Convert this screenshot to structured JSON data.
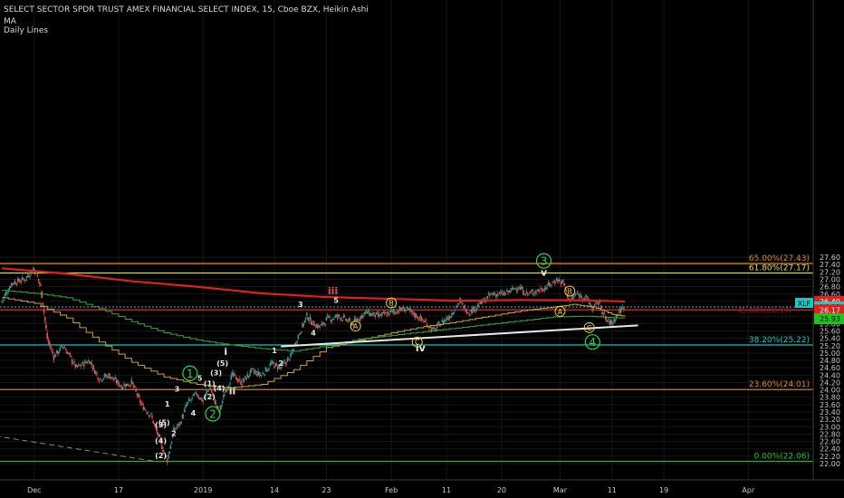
{
  "header": {
    "title": "SELECT SECTOR SPDR TRUST AMEX FINANCIAL SELECT INDEX, 15, Cboe BZX, Heikin Ashi",
    "indicator_1": "MA",
    "indicator_2": "Daily Lines"
  },
  "colors": {
    "background": "#000000",
    "candle_up": "#26a69a",
    "candle_down": "#ef5350",
    "ma_red": "#e0201c",
    "ma_green": "#3aa83a",
    "ma_yellow": "#c8a23a",
    "fib_orange": "#e08a1e",
    "fib_yellow": "#e0e020",
    "fib_cyan": "#1ec8c8",
    "fib_green": "#22c022",
    "trend_white": "#e8e8e8",
    "wave_green": "#22d84a",
    "wave_yellow": "#e8d23a"
  },
  "chart_data": {
    "type": "candlestick",
    "ylim": [
      21.8,
      27.7
    ],
    "x_ticks": [
      {
        "label": "Dec",
        "idx": 10
      },
      {
        "label": "17",
        "idx": 36
      },
      {
        "label": "2019",
        "idx": 62
      },
      {
        "label": "14",
        "idx": 84
      },
      {
        "label": "23",
        "idx": 100
      },
      {
        "label": "Feb",
        "idx": 120
      },
      {
        "label": "11",
        "idx": 137
      },
      {
        "label": "20",
        "idx": 154
      },
      {
        "label": "Mar",
        "idx": 172
      },
      {
        "label": "11",
        "idx": 188
      },
      {
        "label": "19",
        "idx": 204
      },
      {
        "label": "Apr",
        "idx": 230
      }
    ],
    "y_ticks": [
      22.0,
      22.2,
      22.4,
      22.6,
      22.8,
      23.0,
      23.2,
      23.4,
      23.6,
      23.8,
      24.0,
      24.2,
      24.4,
      24.6,
      24.8,
      25.0,
      25.2,
      25.4,
      25.6,
      25.8,
      26.0,
      26.2,
      26.4,
      26.6,
      26.8,
      27.0,
      27.2,
      27.4,
      27.6
    ],
    "price_anchors": [
      [
        0,
        26.4
      ],
      [
        3,
        26.9
      ],
      [
        7,
        27.0
      ],
      [
        10,
        27.3
      ],
      [
        12,
        26.8
      ],
      [
        14,
        25.4
      ],
      [
        16,
        24.9
      ],
      [
        19,
        25.2
      ],
      [
        23,
        24.6
      ],
      [
        27,
        24.8
      ],
      [
        30,
        24.3
      ],
      [
        33,
        24.4
      ],
      [
        37,
        24.1
      ],
      [
        40,
        24.2
      ],
      [
        43,
        23.6
      ],
      [
        46,
        23.3
      ],
      [
        48,
        22.8
      ],
      [
        50,
        22.3
      ],
      [
        51,
        22.1
      ],
      [
        53,
        22.9
      ],
      [
        55,
        23.1
      ],
      [
        57,
        23.6
      ],
      [
        60,
        23.9
      ],
      [
        62,
        23.7
      ],
      [
        64,
        24.1
      ],
      [
        66,
        23.6
      ],
      [
        67,
        23.4
      ],
      [
        69,
        24.0
      ],
      [
        71,
        24.4
      ],
      [
        74,
        24.2
      ],
      [
        77,
        24.5
      ],
      [
        80,
        24.4
      ],
      [
        83,
        24.7
      ],
      [
        86,
        24.6
      ],
      [
        89,
        24.9
      ],
      [
        91,
        25.4
      ],
      [
        94,
        26.0
      ],
      [
        96,
        25.8
      ],
      [
        98,
        25.7
      ],
      [
        100,
        25.9
      ],
      [
        104,
        26.0
      ],
      [
        108,
        25.8
      ],
      [
        112,
        26.1
      ],
      [
        116,
        26.0
      ],
      [
        120,
        26.1
      ],
      [
        124,
        26.2
      ],
      [
        128,
        26.0
      ],
      [
        131,
        25.8
      ],
      [
        133,
        25.6
      ],
      [
        135,
        25.8
      ],
      [
        138,
        26.0
      ],
      [
        141,
        26.4
      ],
      [
        144,
        26.1
      ],
      [
        147,
        26.3
      ],
      [
        151,
        26.6
      ],
      [
        155,
        26.6
      ],
      [
        159,
        26.8
      ],
      [
        162,
        26.6
      ],
      [
        165,
        26.7
      ],
      [
        168,
        26.8
      ],
      [
        171,
        27.0
      ],
      [
        173,
        26.9
      ],
      [
        175,
        26.4
      ],
      [
        177,
        26.6
      ],
      [
        180,
        26.5
      ],
      [
        182,
        26.2
      ],
      [
        184,
        26.4
      ],
      [
        186,
        25.9
      ],
      [
        188,
        25.8
      ],
      [
        190,
        26.1
      ],
      [
        192,
        26.3
      ]
    ],
    "last_index": 192,
    "x_max_index": 250,
    "ma_red": [
      [
        0,
        27.3
      ],
      [
        20,
        27.15
      ],
      [
        40,
        26.95
      ],
      [
        60,
        26.8
      ],
      [
        80,
        26.62
      ],
      [
        100,
        26.52
      ],
      [
        120,
        26.47
      ],
      [
        140,
        26.42
      ],
      [
        160,
        26.44
      ],
      [
        180,
        26.43
      ],
      [
        192,
        26.4
      ]
    ],
    "ma_green": [
      [
        0,
        26.7
      ],
      [
        10,
        26.62
      ],
      [
        20,
        26.5
      ],
      [
        30,
        26.2
      ],
      [
        40,
        25.85
      ],
      [
        50,
        25.55
      ],
      [
        60,
        25.35
      ],
      [
        70,
        25.22
      ],
      [
        80,
        25.12
      ],
      [
        90,
        25.05
      ],
      [
        100,
        25.2
      ],
      [
        110,
        25.38
      ],
      [
        120,
        25.48
      ],
      [
        130,
        25.58
      ],
      [
        140,
        25.68
      ],
      [
        150,
        25.78
      ],
      [
        160,
        25.88
      ],
      [
        170,
        25.98
      ],
      [
        180,
        26.0
      ],
      [
        188,
        25.96
      ],
      [
        192,
        25.95
      ]
    ],
    "ma_yellow": [
      [
        0,
        26.5
      ],
      [
        10,
        26.35
      ],
      [
        20,
        25.95
      ],
      [
        30,
        25.3
      ],
      [
        40,
        24.75
      ],
      [
        50,
        24.35
      ],
      [
        60,
        24.15
      ],
      [
        70,
        24.05
      ],
      [
        80,
        24.15
      ],
      [
        90,
        24.55
      ],
      [
        100,
        25.15
      ],
      [
        110,
        25.35
      ],
      [
        120,
        25.55
      ],
      [
        130,
        25.72
      ],
      [
        140,
        25.85
      ],
      [
        150,
        26.0
      ],
      [
        160,
        26.15
      ],
      [
        170,
        26.25
      ],
      [
        176,
        26.32
      ],
      [
        182,
        26.25
      ],
      [
        188,
        26.05
      ],
      [
        192,
        26.0
      ]
    ],
    "fib_levels": [
      {
        "label": "65.00%(27.43)",
        "value": 27.43,
        "color": "#e08a1e"
      },
      {
        "label": "61.80%(27.17)",
        "value": 27.17,
        "color": "#e0e020"
      },
      {
        "label": "38.20%(25.22)",
        "value": 25.22,
        "color": "#1ec8c8"
      },
      {
        "label": "23.60%(24.01)",
        "value": 24.01,
        "color": "#e08a1e"
      },
      {
        "label": "0.00%(22.06)",
        "value": 22.06,
        "color": "#22c022"
      }
    ],
    "red_hline": {
      "value": 26.17,
      "label": "45.00%(26.17)"
    },
    "price_markers": [
      {
        "label": "26.40",
        "value": 26.4,
        "bg": "#e0201c",
        "fg": "#ffffff"
      },
      {
        "label": "26.25",
        "value": 26.25,
        "bg": "#1ec8c8",
        "fg": "#000000"
      },
      {
        "label": "26.17",
        "value": 26.17,
        "bg": "#e0201c",
        "fg": "#ffffff"
      },
      {
        "label": "25.93",
        "value": 25.93,
        "bg": "#22c022",
        "fg": "#000000"
      }
    ],
    "symbol_tag": "XLF",
    "current_price": 26.25,
    "trendlines": [
      {
        "x1": 86,
        "y1": 25.18,
        "x2": 196,
        "y2": 25.75,
        "color": "#e8e8e8",
        "dashed": false
      },
      {
        "x1": -2,
        "y1": 22.75,
        "x2": 48,
        "y2": 22.05,
        "color": "#8a8a8a",
        "dashed": true
      }
    ],
    "wave_labels": [
      {
        "text": "3",
        "style": "circle-green",
        "idx": 167,
        "price": 27.5
      },
      {
        "text": "4",
        "style": "circle-green",
        "idx": 182,
        "price": 25.3
      },
      {
        "text": "1",
        "style": "circle-green",
        "idx": 58,
        "price": 24.45
      },
      {
        "text": "2",
        "style": "circle-green",
        "idx": 65,
        "price": 23.35
      },
      {
        "text": "v",
        "style": "plain",
        "idx": 167,
        "price": 27.1
      },
      {
        "text": "iii",
        "style": "plain-red",
        "idx": 102,
        "price": 26.6
      },
      {
        "text": "iv",
        "style": "plain",
        "idx": 129,
        "price": 25.05
      },
      {
        "text": "i",
        "style": "plain",
        "idx": 69,
        "price": 24.95
      },
      {
        "text": "ii",
        "style": "plain",
        "idx": 71,
        "price": 23.88
      },
      {
        "text": "B",
        "style": "circle-yellow",
        "idx": 120,
        "price": 26.36
      },
      {
        "text": "A",
        "style": "circle-yellow",
        "idx": 109,
        "price": 25.73
      },
      {
        "text": "C",
        "style": "circle-yellow",
        "idx": 128,
        "price": 25.3
      },
      {
        "text": "B",
        "style": "circle-yellow",
        "idx": 175,
        "price": 26.68
      },
      {
        "text": "A",
        "style": "circle-yellow",
        "idx": 172,
        "price": 26.13
      },
      {
        "text": "C",
        "style": "circle-yellow",
        "idx": 181,
        "price": 25.69
      },
      {
        "text": "3",
        "style": "small",
        "idx": 92,
        "price": 26.25
      },
      {
        "text": "5",
        "style": "small",
        "idx": 103,
        "price": 26.36
      },
      {
        "text": "4",
        "style": "small",
        "idx": 96,
        "price": 25.48
      },
      {
        "text": "1",
        "style": "small",
        "idx": 84,
        "price": 25.0
      },
      {
        "text": "2",
        "style": "small",
        "idx": 86,
        "price": 24.65
      },
      {
        "text": "(5)",
        "style": "small",
        "idx": 68,
        "price": 24.65
      },
      {
        "text": "(3)",
        "style": "small",
        "idx": 66,
        "price": 24.4
      },
      {
        "text": "(1)",
        "style": "small",
        "idx": 64,
        "price": 24.1
      },
      {
        "text": "(4)",
        "style": "small",
        "idx": 67,
        "price": 23.98
      },
      {
        "text": "(2)",
        "style": "small",
        "idx": 64,
        "price": 23.75
      },
      {
        "text": "5",
        "style": "small",
        "idx": 61,
        "price": 24.25
      },
      {
        "text": "3",
        "style": "small",
        "idx": 54,
        "price": 23.95
      },
      {
        "text": "4",
        "style": "small",
        "idx": 59,
        "price": 23.3
      },
      {
        "text": "1",
        "style": "small",
        "idx": 51,
        "price": 23.55
      },
      {
        "text": "2",
        "style": "small",
        "idx": 53,
        "price": 22.75
      },
      {
        "text": "(5)",
        "style": "small",
        "idx": 50,
        "price": 23.05
      },
      {
        "text": "(3)",
        "style": "small",
        "idx": 49,
        "price": 22.98
      },
      {
        "text": "(4)",
        "style": "small",
        "idx": 49,
        "price": 22.55
      },
      {
        "text": "(2)",
        "style": "small",
        "idx": 49,
        "price": 22.15
      }
    ]
  }
}
